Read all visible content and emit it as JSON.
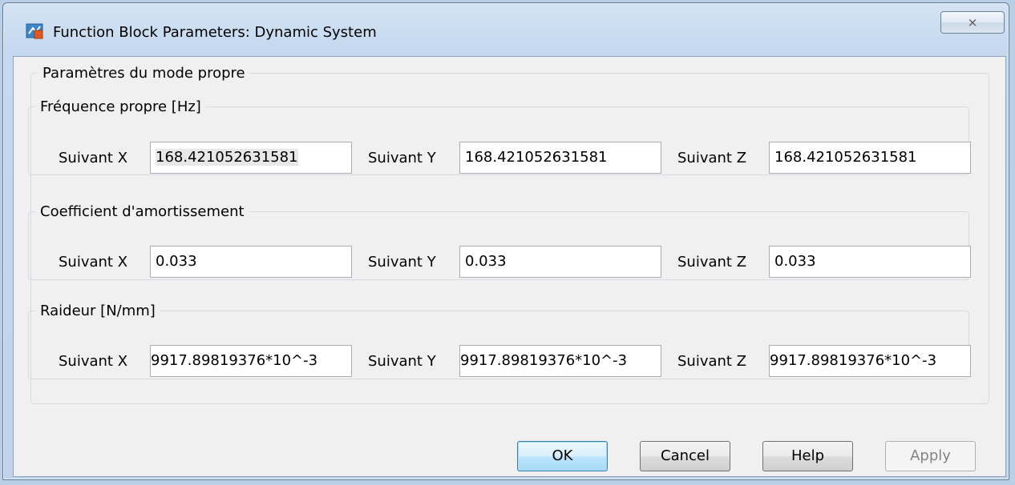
{
  "window": {
    "title": "Function Block Parameters: Dynamic System",
    "close_symbol": "⨯"
  },
  "outer_group": {
    "legend": "Paramètres du mode propre"
  },
  "groups": [
    {
      "legend": "Fréquence propre [Hz]",
      "fields": [
        {
          "label": "Suivant X",
          "value": "168.421052631581"
        },
        {
          "label": "Suivant Y",
          "value": "168.421052631581"
        },
        {
          "label": "Suivant Z",
          "value": "168.421052631581"
        }
      ]
    },
    {
      "legend": "Coefficient d'amortissement",
      "fields": [
        {
          "label": "Suivant X",
          "value": "0.033"
        },
        {
          "label": "Suivant Y",
          "value": "0.033"
        },
        {
          "label": "Suivant Z",
          "value": "0.033"
        }
      ]
    },
    {
      "legend": "Raideur [N/mm]",
      "fields": [
        {
          "label": "Suivant X",
          "value": "9917.89819376*10^-3"
        },
        {
          "label": "Suivant Y",
          "value": "9917.89819376*10^-3"
        },
        {
          "label": "Suivant Z",
          "value": "9917.89819376*10^-3"
        }
      ]
    }
  ],
  "buttons": {
    "ok": "OK",
    "cancel": "Cancel",
    "help": "Help",
    "apply": "Apply"
  },
  "icons": {
    "title_icon": "simulink-block-icon",
    "close_icon": "close-icon"
  }
}
